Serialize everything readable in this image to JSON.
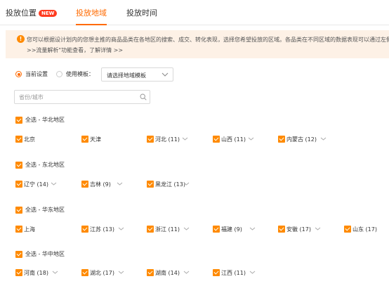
{
  "tabs": [
    {
      "label": "投放位置",
      "badge": "NEW"
    },
    {
      "label": "投放地域"
    },
    {
      "label": "投放时间"
    }
  ],
  "notice": {
    "line1": "您可以根据设计划内的您想主推的商品品类在各地区的搜索、成交、转化表现，选择您希望投放的区域。各品类在不同区域的数据表现可以通过左侧栏\"工",
    "line2": ">>流量解析\"功能查看，了解详情 >>"
  },
  "settings": {
    "current_label": "当前设置",
    "template_label": "使用模板：",
    "select_placeholder": "请选择地域模板"
  },
  "search": {
    "placeholder": "省份/城市"
  },
  "regions": [
    {
      "label": "全选 - 华北地区",
      "provinces": [
        "北京",
        "天津",
        "河北 (11)",
        "山西 (11)",
        "内蒙古 (12)"
      ]
    },
    {
      "label": "全选 - 东北地区",
      "provinces": [
        "辽宁 (14)",
        "吉林 (9)",
        "黑龙江 (13)"
      ]
    },
    {
      "label": "全选 - 华东地区",
      "provinces": [
        "上海",
        "江苏 (13)",
        "浙江 (11)",
        "福建 (9)",
        "安徽 (17)",
        "山东 (17)"
      ]
    },
    {
      "label": "全选 - 华中地区",
      "provinces": [
        "河南 (18)",
        "湖北 (17)",
        "湖南 (14)",
        "江西 (11)"
      ]
    }
  ],
  "colors": {
    "accent": "#ff6a00",
    "checkbox": "#ff8a00",
    "notice_bg": "#fdf1e6",
    "badge": "#ff3b1f"
  }
}
